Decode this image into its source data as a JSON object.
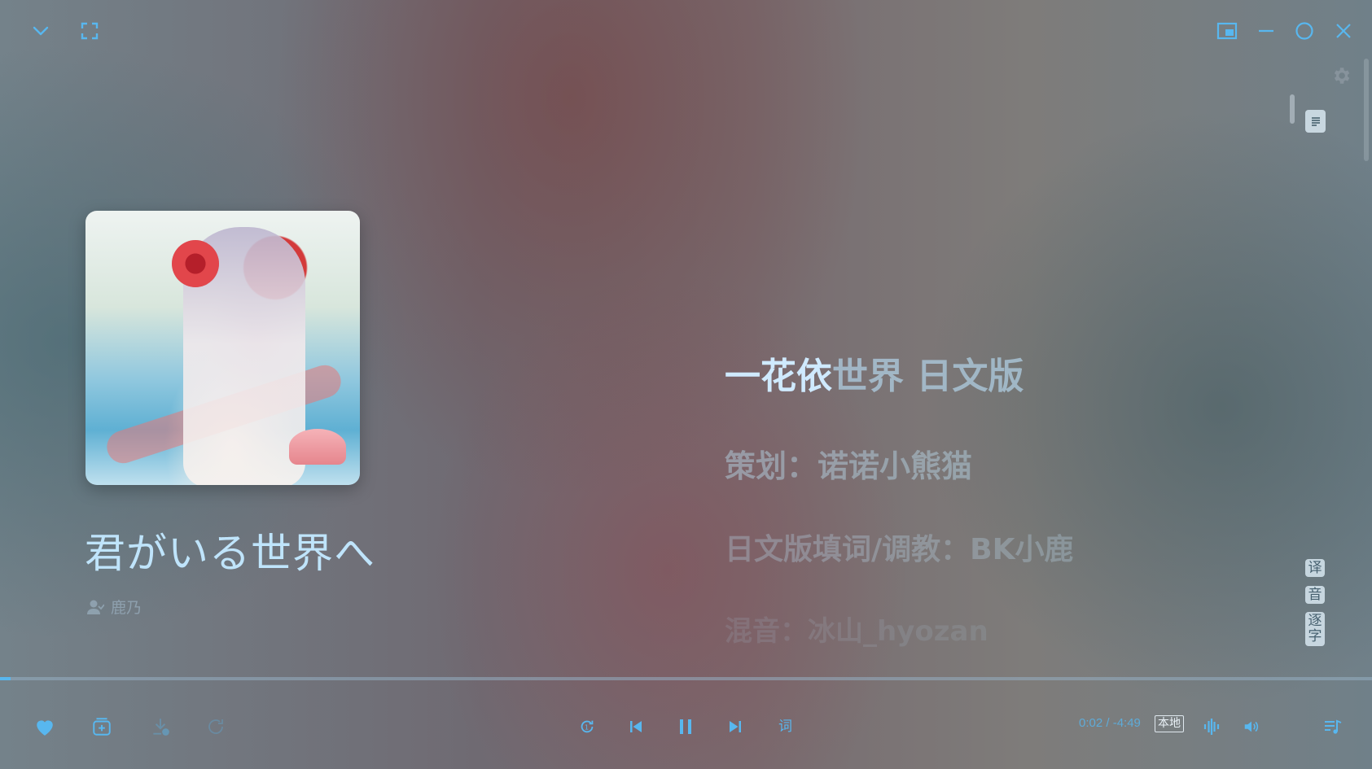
{
  "window": {
    "controls": [
      "collapse",
      "fullscreen",
      "mini-mode",
      "minimize",
      "maximize",
      "close"
    ]
  },
  "song": {
    "title": "君がいる世界へ",
    "artist": "鹿乃"
  },
  "lyrics": {
    "line1_highlighted": "一花依",
    "line1_rest": "世界  日文版",
    "line2": "策划：诺诺小熊猫",
    "line3": "日文版填词/调教：BK小鹿",
    "line4": "混音：冰山_hyozan"
  },
  "side_options": {
    "translate": "译",
    "phonetic": "音",
    "word_by_word": "逐字"
  },
  "playback": {
    "time": "0:02 / -4:49",
    "source": "本地",
    "lyric_label": "词",
    "progress": 0.007,
    "liked": true
  },
  "colors": {
    "accent": "#58b7ef"
  }
}
